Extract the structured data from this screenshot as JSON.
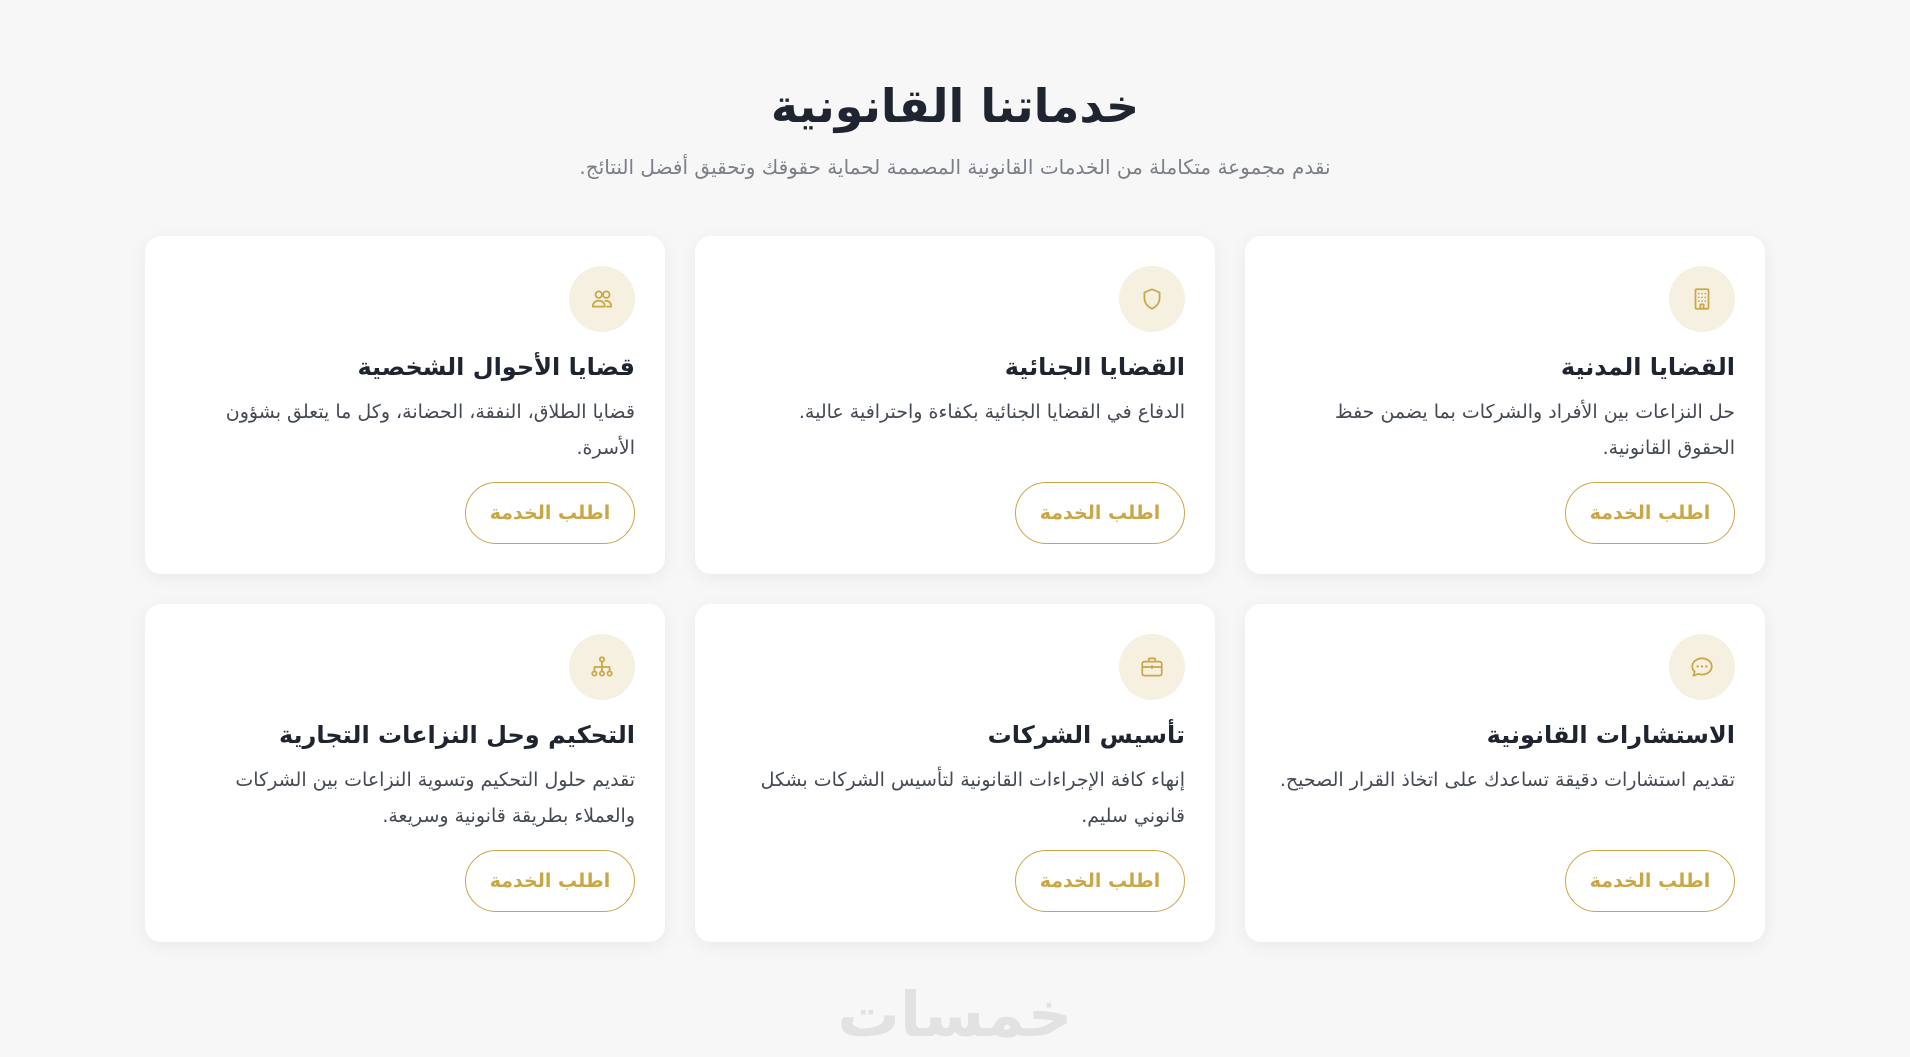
{
  "header": {
    "title": "خدماتنا القانونية",
    "subtitle": "نقدم مجموعة متكاملة من الخدمات القانونية المصممة لحماية حقوقك وتحقيق أفضل النتائج."
  },
  "services": [
    {
      "icon": "building-icon",
      "title": "القضايا المدنية",
      "description": "حل النزاعات بين الأفراد والشركات بما يضمن حفظ الحقوق القانونية.",
      "button": "اطلب الخدمة"
    },
    {
      "icon": "shield-icon",
      "title": "القضايا الجنائية",
      "description": "الدفاع في القضايا الجنائية بكفاءة واحترافية عالية.",
      "button": "اطلب الخدمة"
    },
    {
      "icon": "users-icon",
      "title": "قضايا الأحوال الشخصية",
      "description": "قضايا الطلاق، النفقة، الحضانة، وكل ما يتعلق بشؤون الأسرة.",
      "button": "اطلب الخدمة"
    },
    {
      "icon": "chat-icon",
      "title": "الاستشارات القانونية",
      "description": "تقديم استشارات دقيقة تساعدك على اتخاذ القرار الصحيح.",
      "button": "اطلب الخدمة"
    },
    {
      "icon": "briefcase-icon",
      "title": "تأسيس الشركات",
      "description": "إنهاء كافة الإجراءات القانونية لتأسيس الشركات بشكل قانوني سليم.",
      "button": "اطلب الخدمة"
    },
    {
      "icon": "network-icon",
      "title": "التحكيم وحل النزاعات التجارية",
      "description": "تقديم حلول التحكيم وتسوية النزاعات بين الشركات والعملاء بطريقة قانونية وسريعة.",
      "button": "اطلب الخدمة"
    }
  ],
  "watermark": "خمسات",
  "colors": {
    "accent": "#c9a646",
    "icon_bg": "#f6f0e1",
    "title": "#1f2530",
    "subtitle": "#7a7f88",
    "page_bg": "#f7f7f7"
  }
}
